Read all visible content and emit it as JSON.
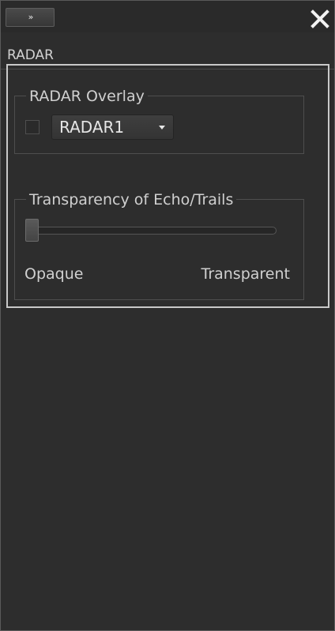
{
  "window": {
    "expand_icon_glyph": "»",
    "close_icon": "close-icon"
  },
  "section": {
    "title": "RADAR"
  },
  "radar_overlay": {
    "group_label": "RADAR Overlay",
    "checkbox_checked": false,
    "selected_source": "RADAR1"
  },
  "transparency": {
    "group_label": "Transparency of Echo/Trails",
    "value_percent": 0,
    "min_label": "Opaque",
    "max_label": "Transparent"
  },
  "colors": {
    "background": "#2d2d2d",
    "text": "#d0d0d0",
    "focus_frame": "#c9c9c9"
  }
}
